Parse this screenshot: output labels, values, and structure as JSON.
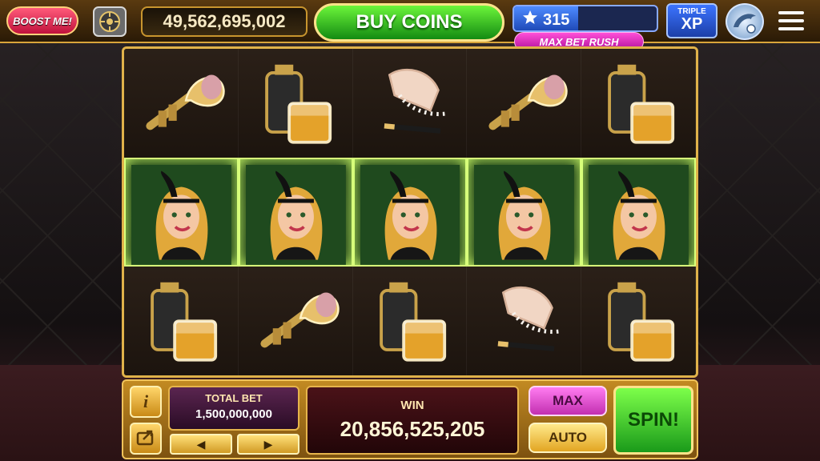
{
  "topbar": {
    "boost_label": "BOOST ME!",
    "balance": "49,562,695,002",
    "buy_label": "BUY COINS",
    "level": "315",
    "level_progress_percent": 45,
    "max_bet_label": "MAX BET RUSH",
    "triple_xp_top": "TRIPLE",
    "triple_xp_bottom": "XP"
  },
  "reels": {
    "rows": [
      [
        "trumpet",
        "whiskey-flask",
        "gloves-pearls",
        "trumpet",
        "whiskey-flask"
      ],
      [
        "flapper-girl",
        "flapper-girl",
        "flapper-girl",
        "flapper-girl",
        "flapper-girl"
      ],
      [
        "whiskey-flask",
        "trumpet",
        "whiskey-flask",
        "gloves-pearls",
        "whiskey-flask"
      ]
    ],
    "winning_row": 1
  },
  "panel": {
    "info_label": "i",
    "total_bet_label": "TOTAL BET",
    "total_bet_value": "1,500,000,000",
    "bet_decrease": "◀",
    "bet_increase": "▶",
    "win_label": "WIN",
    "win_value": "20,856,525,205",
    "max_label": "MAX",
    "auto_label": "AUTO",
    "spin_label": "SPIN!"
  },
  "colors": {
    "gold": "#e0b24a",
    "buy_green": "#3fc824",
    "win_glow": "#d7ff7a",
    "magenta": "#e83ccf"
  }
}
